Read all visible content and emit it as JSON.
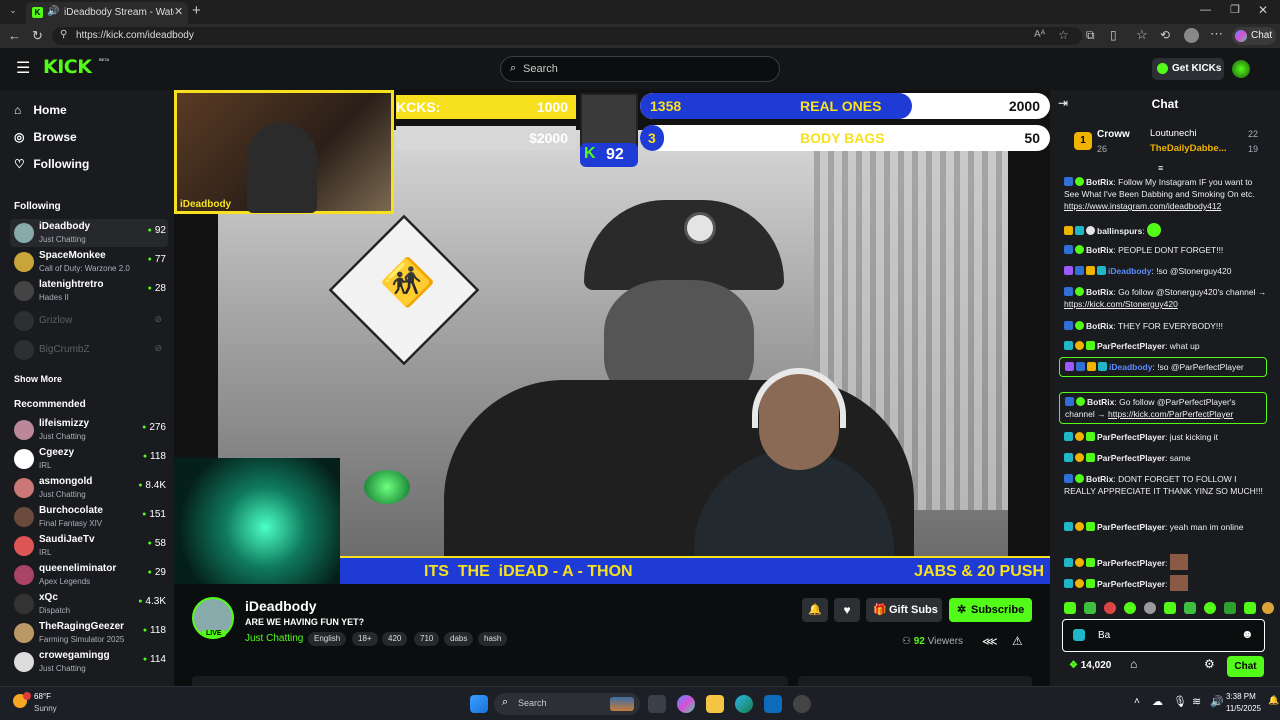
{
  "browser": {
    "tab_title": "iDeadbody Stream - Watch l",
    "url": "https://kick.com/ideadbody",
    "new_tab_icon": "plus",
    "chat_label": "Chat"
  },
  "header": {
    "logo_text": "KICK",
    "logo_beta": "BETA",
    "search_placeholder": "Search",
    "get_kicks_label": "Get KICKs"
  },
  "sidebar": {
    "nav": [
      {
        "label": "Home",
        "icon": "home-icon"
      },
      {
        "label": "Browse",
        "icon": "compass-icon"
      },
      {
        "label": "Following",
        "icon": "heart-icon"
      }
    ],
    "following_heading": "Following",
    "following": [
      {
        "name": "iDeadbody",
        "game": "Just Chatting",
        "viewers": "92",
        "live": true
      },
      {
        "name": "SpaceMonkee",
        "game": "Call of Duty: Warzone 2.0",
        "viewers": "77",
        "live": true
      },
      {
        "name": "latenightretro",
        "game": "Hades II",
        "viewers": "28",
        "live": true
      },
      {
        "name": "Grizlow",
        "game": "",
        "viewers": "",
        "live": false
      },
      {
        "name": "BigCrumbZ",
        "game": "",
        "viewers": "",
        "live": false
      }
    ],
    "show_more_label": "Show More",
    "recommended_heading": "Recommended",
    "recommended": [
      {
        "name": "lifeismizzy",
        "game": "Just Chatting",
        "viewers": "276"
      },
      {
        "name": "Cgeezy",
        "game": "IRL",
        "viewers": "118"
      },
      {
        "name": "asmongold",
        "game": "Just Chatting",
        "viewers": "8.4K"
      },
      {
        "name": "Burchocolate",
        "game": "Final Fantasy XIV",
        "viewers": "151"
      },
      {
        "name": "SaudiJaeTv",
        "game": "IRL",
        "viewers": "58"
      },
      {
        "name": "queeneliminator",
        "game": "Apex Legends",
        "viewers": "29"
      },
      {
        "name": "xQc",
        "game": "Dispatch",
        "viewers": "4.3K"
      },
      {
        "name": "TheRagingGeezer",
        "game": "Farming Simulator 2025",
        "viewers": "118"
      },
      {
        "name": "crowegamingg",
        "game": "Just Chatting",
        "viewers": "114"
      }
    ]
  },
  "video": {
    "webcam_label": "iDeadbody",
    "overlay_left_label": "KCKS:",
    "overlay_left_value": "1000",
    "overlay_left_money": "$2000",
    "k_badge": "92",
    "real_ones_count": "1358",
    "real_ones_label": "REAL ONES",
    "real_ones_goal": "2000",
    "body_bags_count": "3",
    "body_bags_label": "BODY BAGS",
    "body_bags_goal": "50",
    "ticker_left": "ITS  THE  iDEAD - A - THON",
    "ticker_right": "JABS & 20 PUSH"
  },
  "stream_info": {
    "streamer": "iDeadbody",
    "title": "ARE WE HAVING FUN YET?",
    "category": "Just Chatting",
    "live_badge": "LIVE",
    "tags": [
      "English",
      "18+",
      "420",
      "710",
      "dabs",
      "hash"
    ],
    "gift_subs_label": "Gift Subs",
    "subscribe_label": "Subscribe",
    "viewers_count": "92",
    "viewers_label": "Viewers"
  },
  "chat": {
    "title": "Chat",
    "leaderboard": [
      {
        "rank": "1",
        "name": "Croww",
        "count": "26"
      },
      {
        "rank": "",
        "name": "Loutunechi",
        "count": "22"
      },
      {
        "rank": "",
        "name": "TheDailyDabbe...",
        "count": "19"
      }
    ],
    "messages": [
      {
        "user": "BotRix",
        "text": "Follow My Instagram IF you want to See What I've Been Dabbing and Smoking On etc. ",
        "link": "https://www.instagram.com/ideadbody412",
        "color": "#ffffff"
      },
      {
        "user": "ballinspurs",
        "text": "",
        "link": "",
        "color": "#ffffff"
      },
      {
        "user": "BotRix",
        "text": "PEOPLE DONT FORGET!!!",
        "link": "",
        "color": "#ffffff"
      },
      {
        "user": "iDeadbody",
        "text": "!so @Stonerguy420",
        "link": "",
        "color": "#5b8cff"
      },
      {
        "user": "BotRix",
        "text": "Go follow @Stonerguy420's channel → ",
        "link": "https://kick.com/Stonerguy420",
        "color": "#ffffff"
      },
      {
        "user": "BotRix",
        "text": "THEY FOR EVERYBODY!!!",
        "link": "",
        "color": "#ffffff"
      },
      {
        "user": "ParPerfectPlayer",
        "text": "what up",
        "link": "",
        "color": "#ffffff"
      },
      {
        "user": "iDeadbody",
        "text": "!so @ParPerfectPlayer",
        "link": "",
        "color": "#5b8cff"
      },
      {
        "user": "BotRix",
        "text": "Go follow @ParPerfectPlayer's channel → ",
        "link": "https://kick.com/ParPerfectPlayer",
        "color": "#ffffff"
      },
      {
        "user": "ParPerfectPlayer",
        "text": "just kicking it",
        "link": "",
        "color": "#ffffff"
      },
      {
        "user": "ParPerfectPlayer",
        "text": "same",
        "link": "",
        "color": "#ffffff"
      },
      {
        "user": "BotRix",
        "text": "DONT FORGET TO FOLLOW I REALLY APPRECIATE IT THANK YINZ SO MUCH!!!",
        "link": "",
        "color": "#ffffff"
      },
      {
        "user": "ParPerfectPlayer",
        "text": "yeah man im online",
        "link": "",
        "color": "#ffffff"
      },
      {
        "user": "ParPerfectPlayer",
        "text": "",
        "link": "",
        "color": "#ffffff"
      },
      {
        "user": "ParPerfectPlayer",
        "text": "",
        "link": "",
        "color": "#ffffff"
      }
    ],
    "input_value": "Ba",
    "kicks_balance": "14,020",
    "send_label": "Chat"
  },
  "taskbar": {
    "weather_temp": "68°F",
    "weather_desc": "Sunny",
    "search_label": "Search",
    "time": "3:38 PM",
    "date": "11/5/2025"
  },
  "colors": {
    "kick_green": "#53fc18",
    "bg": "#0b0e0f",
    "panel": "#191b1f",
    "overlay_blue": "#1f3bd6",
    "overlay_yellow": "#f7e11f"
  }
}
